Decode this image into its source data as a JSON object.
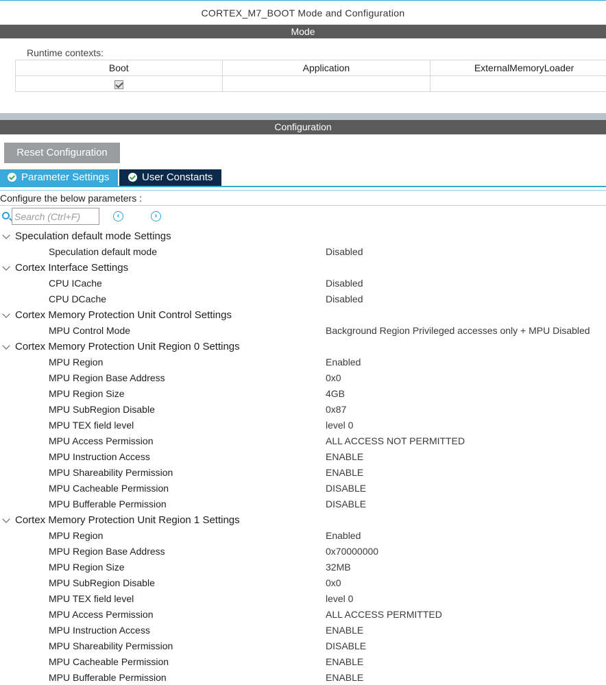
{
  "window_title": "CORTEX_M7_BOOT Mode and Configuration",
  "mode_bar": "Mode",
  "runtime_contexts": {
    "label": "Runtime contexts:",
    "columns": [
      "Boot",
      "Application",
      "ExternalMemoryLoader"
    ],
    "boot_checked": true
  },
  "config_bar": "Configuration",
  "reset_button": "Reset Configuration",
  "tabs": {
    "parameter_settings": "Parameter Settings",
    "user_constants": "User Constants"
  },
  "configure_label": "Configure the below parameters :",
  "search": {
    "placeholder": "Search (Ctrl+F)"
  },
  "icons": {
    "search": "search-icon",
    "prev": "chevron-left-circle-icon",
    "next": "chevron-right-circle-icon",
    "tab_check": "check-circle-icon",
    "expand": "chevron-down-icon"
  },
  "colors": {
    "accent": "#39a9dc",
    "tab_active": "#39a9dc",
    "tab_inactive": "#0b2a4a",
    "header_bar": "#5a5a5a",
    "reset_button": "#9a9da0"
  },
  "groups": [
    {
      "title": "Speculation default mode Settings",
      "params": [
        {
          "name": "Speculation default mode",
          "value": "Disabled"
        }
      ]
    },
    {
      "title": "Cortex Interface Settings",
      "params": [
        {
          "name": "CPU ICache",
          "value": "Disabled"
        },
        {
          "name": "CPU DCache",
          "value": "Disabled"
        }
      ]
    },
    {
      "title": "Cortex Memory Protection Unit Control Settings",
      "params": [
        {
          "name": "MPU Control Mode",
          "value": "Background Region Privileged accesses only + MPU Disabled"
        }
      ]
    },
    {
      "title": "Cortex Memory Protection Unit Region 0 Settings",
      "params": [
        {
          "name": "MPU Region",
          "value": "Enabled"
        },
        {
          "name": "MPU Region Base Address",
          "value": "0x0"
        },
        {
          "name": "MPU Region Size",
          "value": "4GB"
        },
        {
          "name": "MPU SubRegion Disable",
          "value": "0x87"
        },
        {
          "name": "MPU TEX field level",
          "value": "level 0"
        },
        {
          "name": "MPU Access Permission",
          "value": "ALL ACCESS NOT PERMITTED"
        },
        {
          "name": "MPU Instruction Access",
          "value": "ENABLE"
        },
        {
          "name": "MPU Shareability Permission",
          "value": "ENABLE"
        },
        {
          "name": "MPU Cacheable Permission",
          "value": "DISABLE"
        },
        {
          "name": "MPU Bufferable  Permission",
          "value": "DISABLE"
        }
      ]
    },
    {
      "title": "Cortex Memory Protection Unit Region 1 Settings",
      "params": [
        {
          "name": "MPU Region",
          "value": "Enabled"
        },
        {
          "name": "MPU Region Base Address",
          "value": "0x70000000"
        },
        {
          "name": "MPU Region Size",
          "value": "32MB"
        },
        {
          "name": "MPU SubRegion Disable",
          "value": "0x0"
        },
        {
          "name": "MPU TEX field level",
          "value": "level 0"
        },
        {
          "name": "MPU Access Permission",
          "value": "ALL ACCESS PERMITTED"
        },
        {
          "name": "MPU Instruction Access",
          "value": "ENABLE"
        },
        {
          "name": "MPU Shareability Permission",
          "value": "DISABLE"
        },
        {
          "name": "MPU Cacheable Permission",
          "value": "ENABLE"
        },
        {
          "name": "MPU Bufferable  Permission",
          "value": "ENABLE"
        }
      ]
    }
  ]
}
